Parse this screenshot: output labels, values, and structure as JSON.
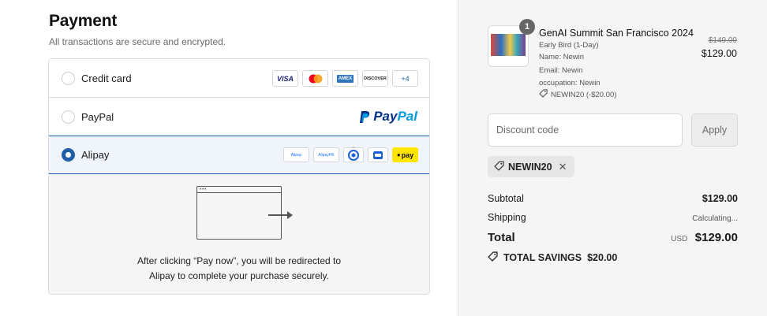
{
  "payment": {
    "title": "Payment",
    "subtitle": "All transactions are secure and encrypted.",
    "methods": [
      {
        "label": "Credit card",
        "selected": false
      },
      {
        "label": "PayPal",
        "selected": false
      },
      {
        "label": "Alipay",
        "selected": true
      }
    ],
    "cards": {
      "visa": "VISA",
      "amex": "AMEX",
      "discover": "DISCOVER",
      "more": "+4"
    },
    "paypal": {
      "pay": "Pay",
      "pal": "Pal"
    },
    "alipay_logos": {
      "alipay": "Alipay",
      "alipayhk": "AlipayHK",
      "kakao": "pay"
    },
    "redirect_line1": "After clicking “Pay now”, you will be redirected to",
    "redirect_line2": "Alipay to complete your purchase securely."
  },
  "summary": {
    "quantity": "1",
    "product_name": "GenAI Summit San Francisco 2024",
    "variant": "Early Bird (1-Day)",
    "name_line": "Name: Newin",
    "email_line": "Email: Newin",
    "occupation_line": "occupation: Newin",
    "discount_line": "NEWIN20 (-$20.00)",
    "original_price": "$149.00",
    "price": "$129.00",
    "discount_placeholder": "Discount code",
    "apply_label": "Apply",
    "applied_code": "NEWIN20",
    "subtotal_label": "Subtotal",
    "subtotal_value": "$129.00",
    "shipping_label": "Shipping",
    "shipping_value": "Calculating...",
    "total_label": "Total",
    "total_currency": "USD",
    "total_value": "$129.00",
    "savings_label": "TOTAL SAVINGS",
    "savings_value": "$20.00"
  },
  "colors": {
    "accent": "#1f5fa8",
    "summary_bg": "#f5f5f5"
  }
}
